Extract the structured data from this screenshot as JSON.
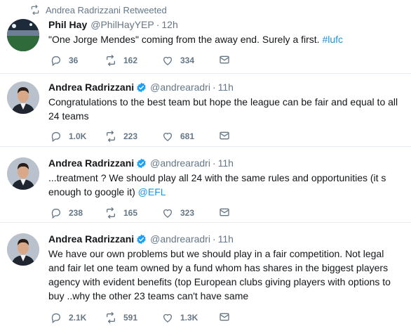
{
  "retweet_context": {
    "label": "Andrea Radrizzani Retweeted"
  },
  "tweets": [
    {
      "name": "Phil Hay",
      "handle": "@PhilHayYEP",
      "time": "12h",
      "verified": false,
      "text_before": "\"One Jorge Mendes\" coming from the away end. Surely a first. ",
      "hashtag": "#lufc",
      "replies": "36",
      "retweets": "162",
      "likes": "334"
    },
    {
      "name": "Andrea Radrizzani",
      "handle": "@andrearadri",
      "time": "11h",
      "verified": true,
      "line1": "Congratulations to the best team but hope the league can be fair and equal to all",
      "line2": "24 teams",
      "replies": "1.0K",
      "retweets": "223",
      "likes": "681"
    },
    {
      "name": "Andrea Radrizzani",
      "handle": "@andrearadri",
      "time": "11h",
      "verified": true,
      "line1": "...treatment ? We should play all 24 with the same rules and opportunities (it s",
      "line2": "enough to google it) ",
      "mention": "@EFL",
      "replies": "238",
      "retweets": "165",
      "likes": "323"
    },
    {
      "name": "Andrea Radrizzani",
      "handle": "@andrearadri",
      "time": "11h",
      "verified": true,
      "line1": "We have our own problems but we should play in a fair competition. Not legal",
      "line2": "and fair let one team owned by a fund whom has shares in the biggest players",
      "line3": "agency with evident benefits (top European clubs giving players with options to",
      "line4": "buy ..why the other 23 teams can't have same",
      "replies": "2.1K",
      "retweets": "591",
      "likes": "1.3K"
    }
  ],
  "colors": {
    "verified": "#1da1f2",
    "link": "#1b95e0",
    "muted": "#657786",
    "divider": "#e6ecf0"
  }
}
